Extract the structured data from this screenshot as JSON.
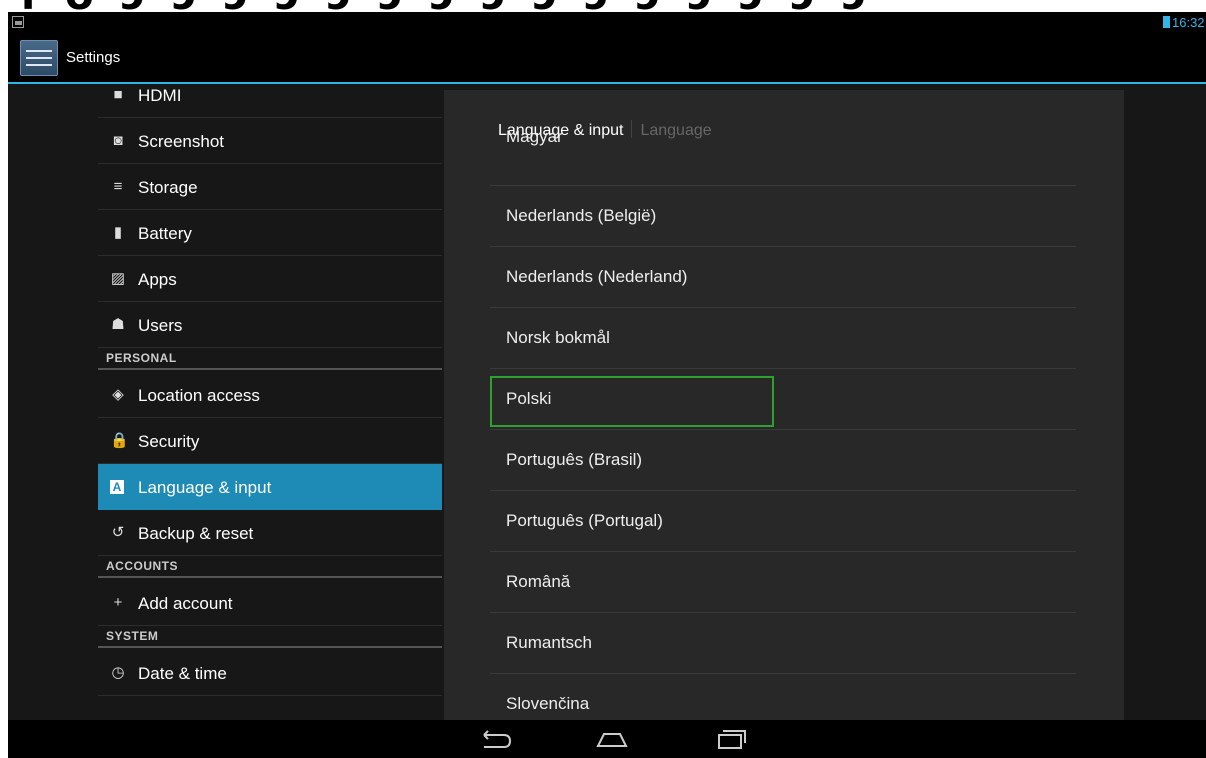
{
  "status_bar": {
    "time": "16:32"
  },
  "action_bar": {
    "title": "Settings"
  },
  "left_menu": {
    "entries": [
      {
        "kind": "item",
        "label": "HDMI",
        "icon": "hdmi-icon"
      },
      {
        "kind": "item",
        "label": "Screenshot",
        "icon": "camera-icon"
      },
      {
        "kind": "item",
        "label": "Storage",
        "icon": "storage-icon"
      },
      {
        "kind": "item",
        "label": "Battery",
        "icon": "battery-icon"
      },
      {
        "kind": "item",
        "label": "Apps",
        "icon": "apps-icon"
      },
      {
        "kind": "item",
        "label": "Users",
        "icon": "users-icon"
      },
      {
        "kind": "header",
        "label": "PERSONAL"
      },
      {
        "kind": "item",
        "label": "Location access",
        "icon": "location-icon"
      },
      {
        "kind": "item",
        "label": "Security",
        "icon": "lock-icon"
      },
      {
        "kind": "item",
        "label": "Language & input",
        "icon": "language-icon",
        "active": true
      },
      {
        "kind": "item",
        "label": "Backup & reset",
        "icon": "backup-icon"
      },
      {
        "kind": "header",
        "label": "ACCOUNTS"
      },
      {
        "kind": "item",
        "label": "Add account",
        "icon": "plus-icon"
      },
      {
        "kind": "header",
        "label": "SYSTEM"
      },
      {
        "kind": "item",
        "label": "Date & time",
        "icon": "clock-icon"
      }
    ]
  },
  "detail": {
    "breadcrumb_main": "Language & input",
    "breadcrumb_sub": "Language",
    "languages": [
      "Magyar",
      "Nederlands (België)",
      "Nederlands (Nederland)",
      "Norsk bokmål",
      "Polski",
      "Português (Brasil)",
      "Português (Portugal)",
      "Română",
      "Rumantsch",
      "Slovenčina"
    ],
    "focused_language": "Polski"
  },
  "colors": {
    "accent": "#33b5e5",
    "active_item": "#1d8bb5",
    "focus": "#2ea02e"
  }
}
